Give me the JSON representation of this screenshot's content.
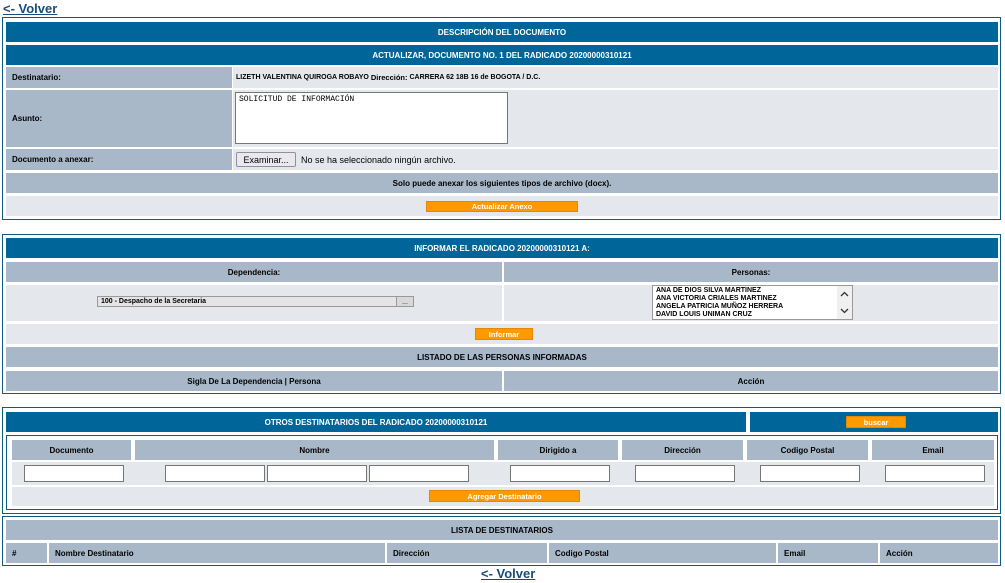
{
  "nav": {
    "back_top": "<- Volver",
    "back_bottom": "<- Volver"
  },
  "doc": {
    "title": "DESCRIPCIÓN DEL DOCUMENTO",
    "subtitle": "ACTUALIZAR, DOCUMENTO NO. 1 DEL RADICADO 20200000310121",
    "destinatario_label": "Destinatario:",
    "destinatario_name": "LIZETH VALENTINA QUIROGA ROBAYO",
    "direccion_label": "Dirección:",
    "direccion_value": "CARRERA 62 18B 16 de BOGOTA / D.C.",
    "asunto_label": "Asunto:",
    "asunto_value": "SOLICITUD DE INFORMACIÓN",
    "anexar_label": "Documento a anexar:",
    "file_button": "Examinar...",
    "file_status": "No se ha seleccionado ningún archivo.",
    "file_types_note": "Solo puede anexar los siguientes tipos de archivo (docx).",
    "update_button": "Actualizar Anexo"
  },
  "informar": {
    "title": "INFORMAR EL RADICADO 20200000310121 A:",
    "dependencia_header": "Dependencia:",
    "personas_header": "Personas:",
    "dependencia_selected": "100 - Despacho de la Secretaria",
    "personas": [
      "ANA DE DIOS SILVA MARTINEZ",
      "ANA VICTORIA CRIALES MARTINEZ",
      "ANGELA PATRICIA MUÑOZ HERRERA",
      "DAVID LOUIS UNIMAN CRUZ"
    ],
    "informar_button": "Informar",
    "listado_title": "LISTADO DE LAS PERSONAS INFORMADAS",
    "col_sigla": "Sigla De La Dependencia | Persona",
    "col_accion": "Acción"
  },
  "otros": {
    "title": "OTROS DESTINATARIOS DEL RADICADO 20200000310121",
    "buscar_button": "buscar",
    "columns": {
      "documento": "Documento",
      "nombre": "Nombre",
      "dirigido": "Dirigido a",
      "direccion": "Dirección",
      "postal": "Codigo Postal",
      "email": "Email"
    },
    "agregar_button": "Agregar Destinatario"
  },
  "lista": {
    "title": "LISTA DE DESTINATARIOS",
    "columns": {
      "num": "#",
      "nombre": "Nombre Destinatario",
      "direccion": "Dirección",
      "postal": "Codigo Postal",
      "email": "Email",
      "accion": "Acción"
    }
  }
}
